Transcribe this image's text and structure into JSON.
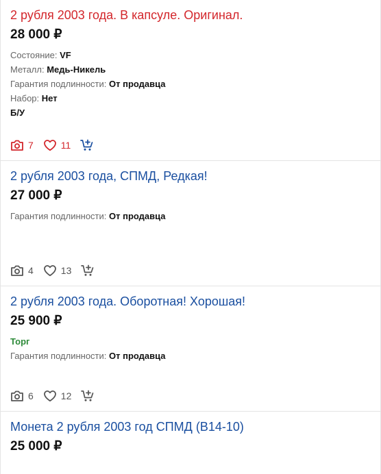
{
  "listings": [
    {
      "title": "2 рубля 2003 года. В капсуле. Оригинал.",
      "price": "28 000 ₽",
      "props": [
        {
          "label": "Состояние: ",
          "value": "VF"
        },
        {
          "label": "Металл: ",
          "value": "Медь-Никель"
        },
        {
          "label": "Гарантия подлинности: ",
          "value": "От продавца"
        },
        {
          "label": "Набор: ",
          "value": "Нет"
        }
      ],
      "extra": "Б/У",
      "photos": "7",
      "likes": "11"
    },
    {
      "title": "2 рубля 2003 года, СПМД, Редкая!",
      "price": "27 000 ₽",
      "props": [
        {
          "label": "Гарантия подлинности: ",
          "value": "От продавца"
        }
      ],
      "photos": "4",
      "likes": "13"
    },
    {
      "title": "2 рубля 2003 года. Оборотная! Хорошая!",
      "price": "25 900 ₽",
      "badge": "Торг",
      "props": [
        {
          "label": "Гарантия подлинности: ",
          "value": "От продавца"
        }
      ],
      "photos": "6",
      "likes": "12"
    },
    {
      "title": "Монета 2 рубля 2003 год СПМД (В14-10)",
      "price": "25 000 ₽"
    }
  ],
  "colors": {
    "title_link": "#1a4fa0",
    "title_visited_red": "#d3262b",
    "torg_green": "#2e8b3a",
    "icon_gray": "#555555"
  },
  "icons": [
    "camera-icon",
    "heart-icon",
    "cart-plus-icon"
  ]
}
